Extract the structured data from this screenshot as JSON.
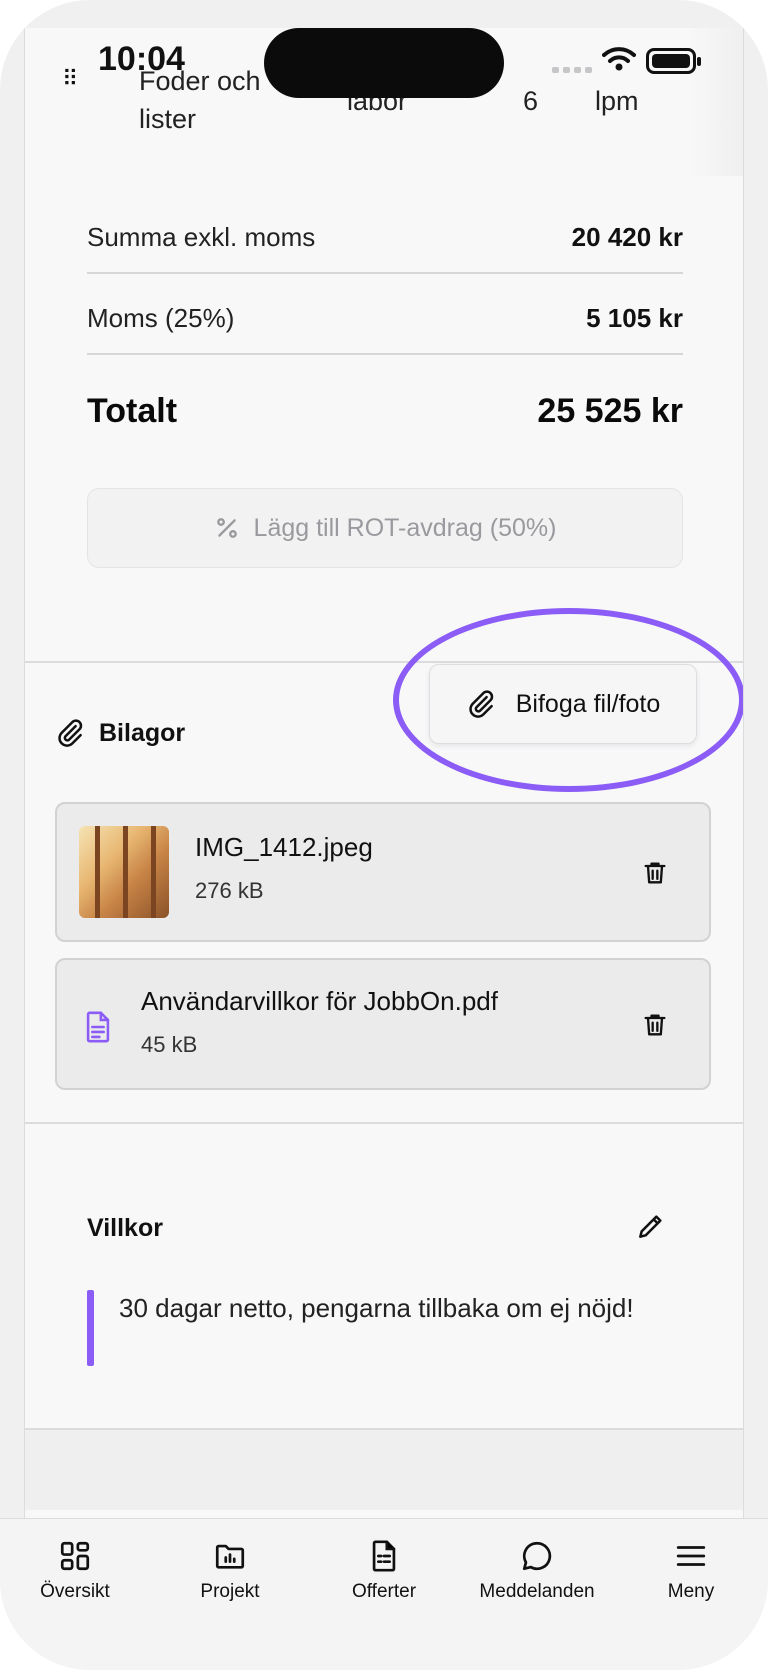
{
  "status_bar": {
    "time": "10:04"
  },
  "peek_row": {
    "name": "Foder och lister",
    "type": "labor",
    "qty": "6",
    "unit": "lpm"
  },
  "summary": {
    "subtotal_label": "Summa exkl. moms",
    "subtotal_value": "20 420 kr",
    "vat_label": "Moms (25%)",
    "vat_value": "5 105 kr",
    "total_label": "Totalt",
    "total_value": "25 525 kr",
    "rot_button_label": "Lägg till ROT-avdrag (50%)"
  },
  "attachments": {
    "title": "Bilagor",
    "attach_button_label": "Bifoga fil/foto",
    "files": [
      {
        "name": "IMG_1412.jpeg",
        "size": "276 kB"
      },
      {
        "name": "Användarvillkor för JobbOn.pdf",
        "size": "45 kB"
      }
    ]
  },
  "terms": {
    "title": "Villkor",
    "text": "30 dagar netto, pengarna tillbaka om ej nöjd!"
  },
  "tabbar": {
    "items": [
      {
        "label": "Översikt",
        "icon": "grid-icon"
      },
      {
        "label": "Projekt",
        "icon": "folder-chart-icon"
      },
      {
        "label": "Offerter",
        "icon": "document-icon"
      },
      {
        "label": "Meddelanden",
        "icon": "chat-bubble-icon"
      },
      {
        "label": "Meny",
        "icon": "hamburger-menu-icon"
      }
    ]
  },
  "colors": {
    "accent": "#8b5cf6",
    "background": "#f8f8f9"
  }
}
